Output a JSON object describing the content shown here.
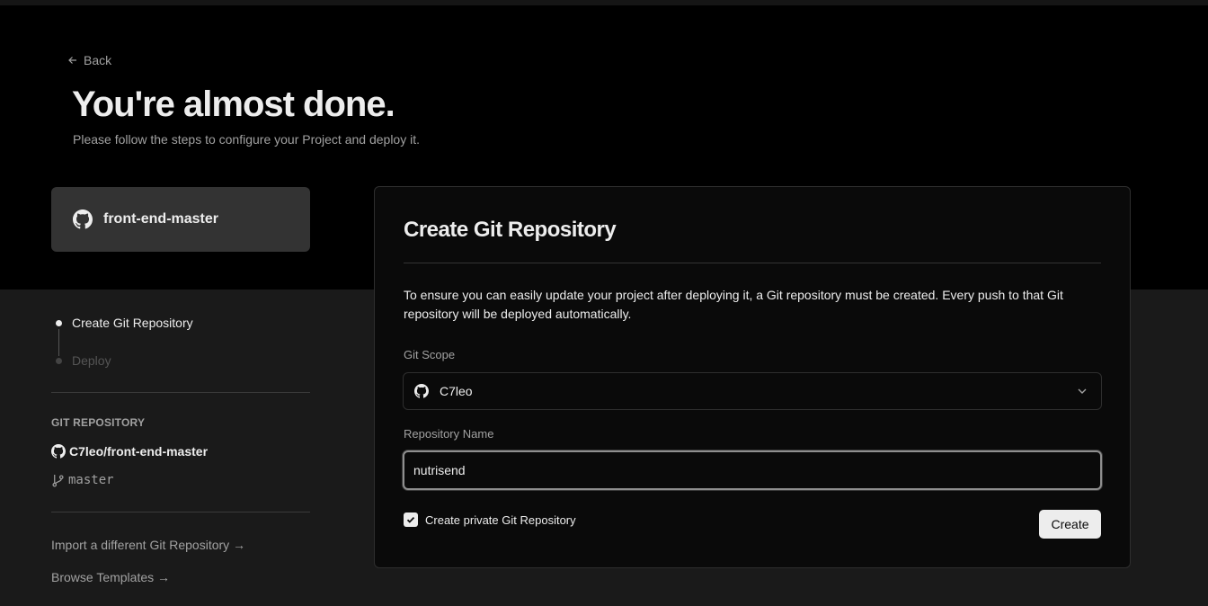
{
  "header": {
    "back_label": "Back",
    "title": "You're almost done.",
    "subtitle": "Please follow the steps to configure your Project and deploy it."
  },
  "project_card": {
    "icon": "github-icon",
    "name": "front-end-master"
  },
  "steps": [
    {
      "label": "Create Git Repository",
      "state": "active"
    },
    {
      "label": "Deploy",
      "state": "pending"
    }
  ],
  "git_repository": {
    "section_label": "GIT REPOSITORY",
    "full_name": "C7leo/front-end-master",
    "branch": "master"
  },
  "side_links": {
    "import_label": "Import a different Git Repository →",
    "browse_label": "Browse Templates →"
  },
  "panel": {
    "title": "Create Git Repository",
    "description": "To ensure you can easily update your project after deploying it, a Git repository must be created. Every push to that Git repository will be deployed automatically.",
    "scope_label": "Git Scope",
    "scope_value": "C7leo",
    "repo_name_label": "Repository Name",
    "repo_name_value": "nutrisend",
    "private_label": "Create private Git Repository",
    "private_checked": true,
    "create_label": "Create"
  },
  "colors": {
    "hero_bg": "#000000",
    "page_bg": "#1a1a1a",
    "card_bg": "#333333",
    "text_primary": "#ededed",
    "text_secondary": "#a1a1a1"
  }
}
